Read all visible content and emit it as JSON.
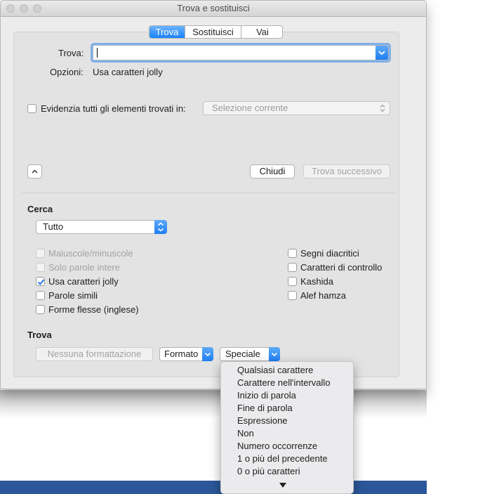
{
  "window": {
    "title": "Trova e sostituisci"
  },
  "tabs": [
    {
      "label": "Trova",
      "active": true
    },
    {
      "label": "Sostituisci",
      "active": false
    },
    {
      "label": "Vai",
      "active": false
    }
  ],
  "find": {
    "label": "Trova:",
    "value": "",
    "options_label": "Opzioni:",
    "options_value": "Usa caratteri jolly"
  },
  "highlight": {
    "label": "Evidenzia tutti gli elementi trovati in:",
    "checked": false,
    "scope": "Selezione corrente"
  },
  "buttons": {
    "close": "Chiudi",
    "find_next": "Trova successivo"
  },
  "search": {
    "heading": "Cerca",
    "direction": "Tutto",
    "left_options": [
      {
        "label": "Maiuscole/minuscole",
        "checked": false,
        "enabled": false
      },
      {
        "label": "Solo parole intere",
        "checked": false,
        "enabled": false
      },
      {
        "label": "Usa caratteri jolly",
        "checked": true,
        "enabled": true
      },
      {
        "label": "Parole simili",
        "checked": false,
        "enabled": true
      },
      {
        "label": "Forme flesse (inglese)",
        "checked": false,
        "enabled": true
      }
    ],
    "right_options": [
      {
        "label": "Segni diacritici",
        "checked": false,
        "enabled": true
      },
      {
        "label": "Caratteri di controllo",
        "checked": false,
        "enabled": true
      },
      {
        "label": "Kashida",
        "checked": false,
        "enabled": true
      },
      {
        "label": "Alef hamza",
        "checked": false,
        "enabled": true
      }
    ]
  },
  "format_section": {
    "heading": "Trova",
    "no_format": "Nessuna formattazione",
    "format": "Formato",
    "special": "Speciale"
  },
  "special_menu": [
    "Qualsiasi carattere",
    "Carattere nell'intervallo",
    "Inizio di parola",
    "Fine di parola",
    "Espressione",
    "Non",
    "Numero occorrenze",
    "1 o più del precedente",
    "0 o più caratteri"
  ],
  "colors": {
    "accent": "#1a82fb",
    "focus_ring": "#7fb0ea"
  }
}
